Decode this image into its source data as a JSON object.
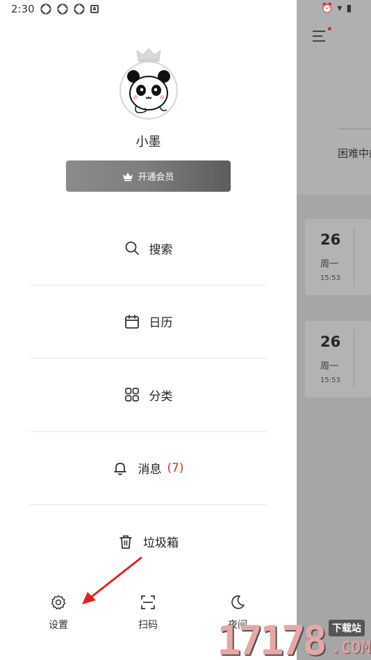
{
  "status_bar": {
    "time": "2:30",
    "notif_box_icon": "A"
  },
  "profile": {
    "username": "小墨",
    "vip_label": "开通会员"
  },
  "menu": {
    "items": [
      {
        "label": "搜索",
        "icon": "search-icon"
      },
      {
        "label": "日历",
        "icon": "calendar-icon"
      },
      {
        "label": "分类",
        "icon": "grid-icon"
      },
      {
        "label": "消息",
        "icon": "bell-icon",
        "count": "(7)"
      },
      {
        "label": "垃圾箱",
        "icon": "trash-icon"
      }
    ]
  },
  "bottom_bar": {
    "settings": "设置",
    "scan": "扫码",
    "night": "夜间"
  },
  "background": {
    "partial_text": "困难中的",
    "cards": [
      {
        "day": "26",
        "weekday": "周一",
        "time": "15:53"
      },
      {
        "day": "26",
        "weekday": "周一",
        "time": "15:53"
      }
    ]
  },
  "watermark": {
    "number": "17178",
    "tag": "下载站",
    "domain": ".COM"
  },
  "colors": {
    "accent_red": "#c0392b",
    "vip_gradient_start": "#8b8b8b",
    "vip_gradient_end": "#5c5c5c"
  }
}
